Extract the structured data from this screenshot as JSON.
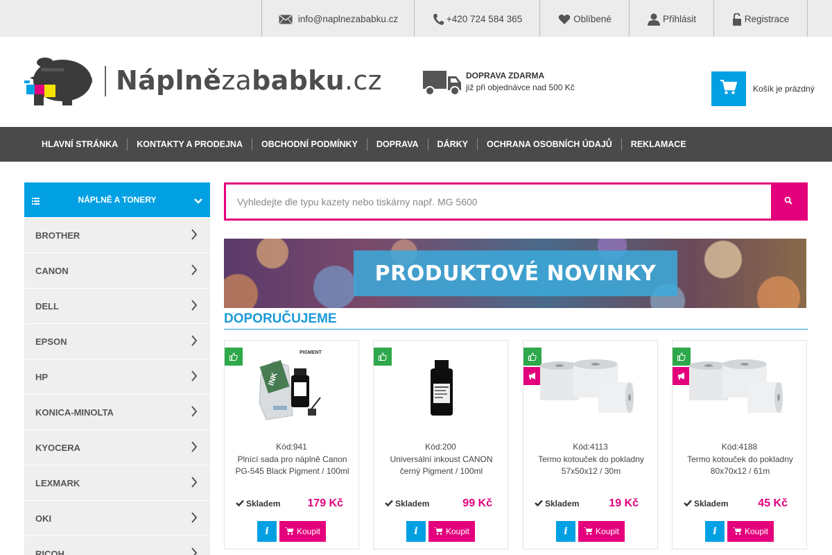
{
  "topbar": {
    "email": "info@naplnezababku.cz",
    "phone": "+420 724 584 365",
    "favorites": "Oblíbené",
    "login": "Přihlásit",
    "register": "Registrace"
  },
  "logo": {
    "part1": "Náplně",
    "part2": "za",
    "part3": "babku",
    "part4": ".cz"
  },
  "shipping": {
    "title": "DOPRAVA ZDARMA",
    "subtitle": "již při objednávce nad 500 Kč"
  },
  "cart": {
    "label": "Košík je prázdný"
  },
  "nav": {
    "items": [
      "HLAVNÍ STRÁNKA",
      "KONTAKTY A PRODEJNA",
      "OBCHODNÍ PODMÍNKY",
      "DOPRAVA",
      "DÁRKY",
      "OCHRANA OSOBNÍCH ÚDAJŮ",
      "REKLAMACE"
    ]
  },
  "sidebar": {
    "heading": "NÁPLNĚ A TONERY",
    "items": [
      "BROTHER",
      "CANON",
      "DELL",
      "EPSON",
      "HP",
      "KONICA-MINOLTA",
      "KYOCERA",
      "LEXMARK",
      "OKI",
      "RICOH"
    ]
  },
  "search": {
    "placeholder": "Vyhledejte dle typu kazety nebo tiskárny např. MG 5600"
  },
  "banner": {
    "text": "PRODUKTOVÉ NOVINKY"
  },
  "section": {
    "title": "DOPORUČUJEME"
  },
  "colors": {
    "accent_pink": "#e4007c",
    "accent_blue": "#00a0e3",
    "badge_green": "#2ea84a"
  },
  "products": [
    {
      "code": "Kód:941",
      "name": "Plnící sada pro náplně Canon PG-545 Black Pigment / 100ml",
      "stock": "Skladem",
      "price": "179 Kč",
      "buy": "Koupit",
      "badges": [
        "thumbs-up-icon"
      ]
    },
    {
      "code": "Kód:200",
      "name": "Universální inkoust CANON černý Pigment / 100ml",
      "stock": "Skladem",
      "price": "99 Kč",
      "buy": "Koupit",
      "badges": [
        "thumbs-up-icon"
      ]
    },
    {
      "code": "Kód:4113",
      "name": "Termo kotouček do pokladny 57x50x12 / 30m",
      "stock": "Skladem",
      "price": "19 Kč",
      "buy": "Koupit",
      "badges": [
        "thumbs-up-icon",
        "megaphone-icon"
      ]
    },
    {
      "code": "Kód:4188",
      "name": "Termo kotouček do pokladny 80x70x12 / 61m",
      "stock": "Skladem",
      "price": "45 Kč",
      "buy": "Koupit",
      "badges": [
        "thumbs-up-icon",
        "megaphone-icon"
      ]
    }
  ]
}
